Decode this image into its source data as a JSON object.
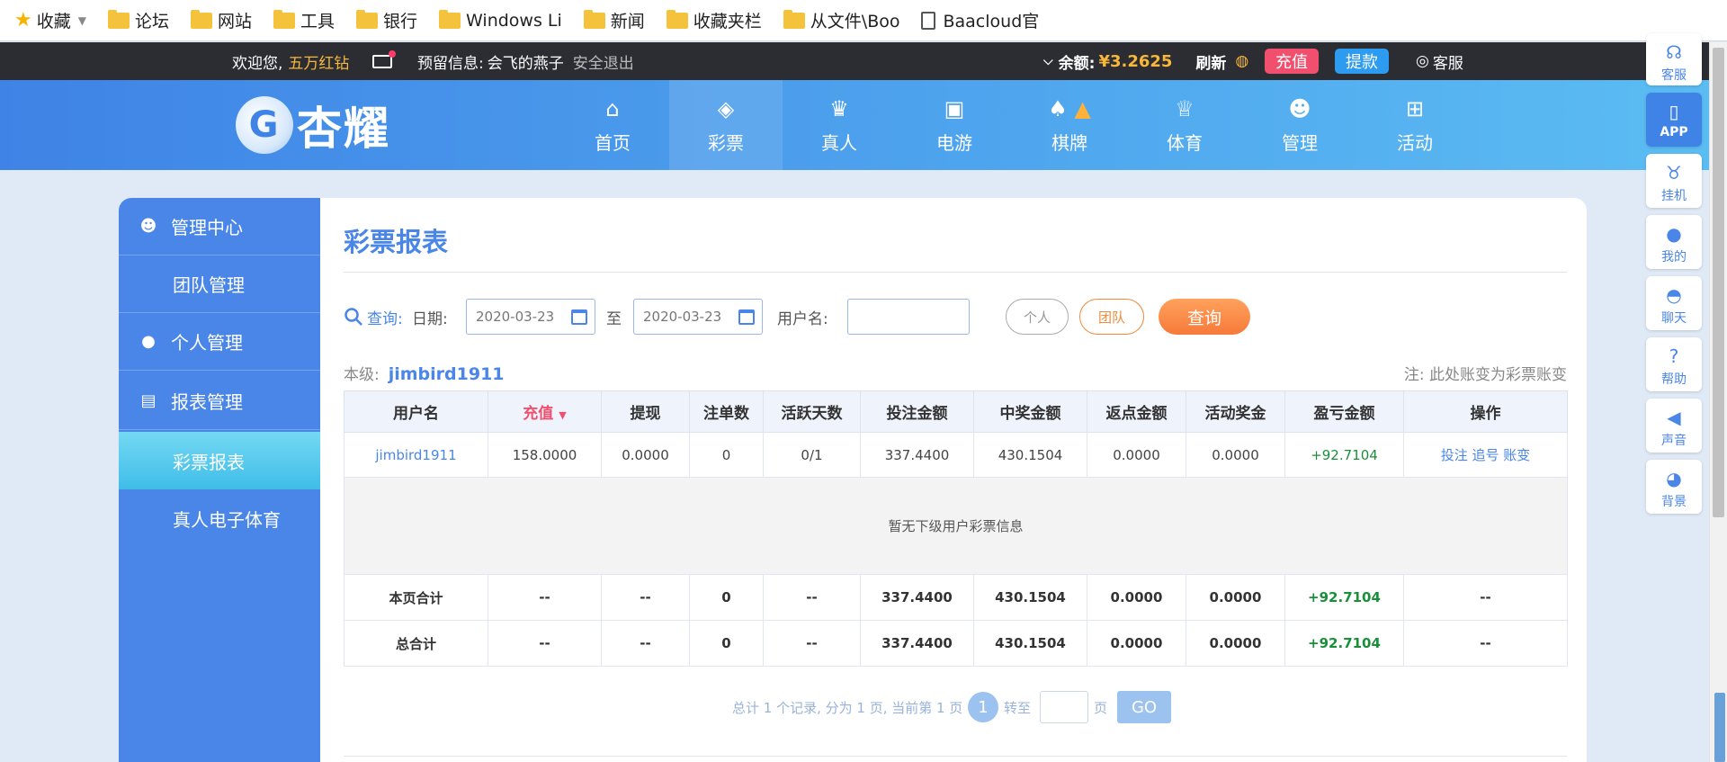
{
  "bookmarks": {
    "items": [
      "收藏",
      "论坛",
      "网站",
      "工具",
      "银行",
      "Windows Li",
      "新闻",
      "收藏夹栏",
      "从文件\\Boo",
      "Baacloud官"
    ]
  },
  "topbar": {
    "welcome": "欢迎您,",
    "username": "五万红钻",
    "reserved_label": "预留信息:",
    "reserved_value": "会飞的燕子",
    "logout": "安全退出",
    "balance_label": "余额:",
    "balance_value": "¥3.2625",
    "refresh": "刷新",
    "recharge": "充值",
    "withdraw": "提款",
    "service": "客服"
  },
  "header": {
    "logo_text": "杏耀",
    "nav": [
      "首页",
      "彩票",
      "真人",
      "电游",
      "棋牌",
      "体育",
      "管理",
      "活动"
    ],
    "active_nav": "彩票"
  },
  "sidebar": {
    "items": [
      "管理中心",
      "团队管理",
      "个人管理",
      "报表管理",
      "彩票报表",
      "真人电子体育"
    ],
    "active": "彩票报表"
  },
  "report": {
    "title": "彩票报表",
    "query_label": "查询:",
    "date_label": "日期:",
    "date_from": "2020-03-23",
    "to_label": "至",
    "date_to": "2020-03-23",
    "username_label": "用户名:",
    "username_value": "",
    "btn_personal": "个人",
    "btn_team": "团队",
    "btn_query": "查询",
    "level_label": "本级:",
    "level_user": "jimbird1911",
    "note": "注: 此处账变为彩票账变"
  },
  "table": {
    "columns": [
      "用户名",
      "充值",
      "提现",
      "注单数",
      "活跃天数",
      "投注金额",
      "中奖金额",
      "返点金额",
      "活动奖金",
      "盈亏金额",
      "操作"
    ],
    "row": [
      "jimbird1911",
      "158.0000",
      "0.0000",
      "0",
      "0/1",
      "337.4400",
      "430.1504",
      "0.0000",
      "0.0000",
      "+92.7104"
    ],
    "row_actions": "投注 追号 账变",
    "empty_text": "暂无下级用户彩票信息",
    "page_total": [
      "本页合计",
      "--",
      "--",
      "0",
      "--",
      "337.4400",
      "430.1504",
      "0.0000",
      "0.0000",
      "+92.7104",
      "--"
    ],
    "grand_total": [
      "总合计",
      "--",
      "--",
      "0",
      "--",
      "337.4400",
      "430.1504",
      "0.0000",
      "0.0000",
      "+92.7104",
      "--"
    ]
  },
  "pager": {
    "summary": "总计 1 个记录, 分为 1 页, 当前第 1 页",
    "current_page": "1",
    "goto_label": "转至",
    "page_unit": "页",
    "go": "GO"
  },
  "floatbar": {
    "items": [
      "客服",
      "APP",
      "挂机",
      "我的",
      "聊天",
      "帮助",
      "声音",
      "背景"
    ]
  }
}
